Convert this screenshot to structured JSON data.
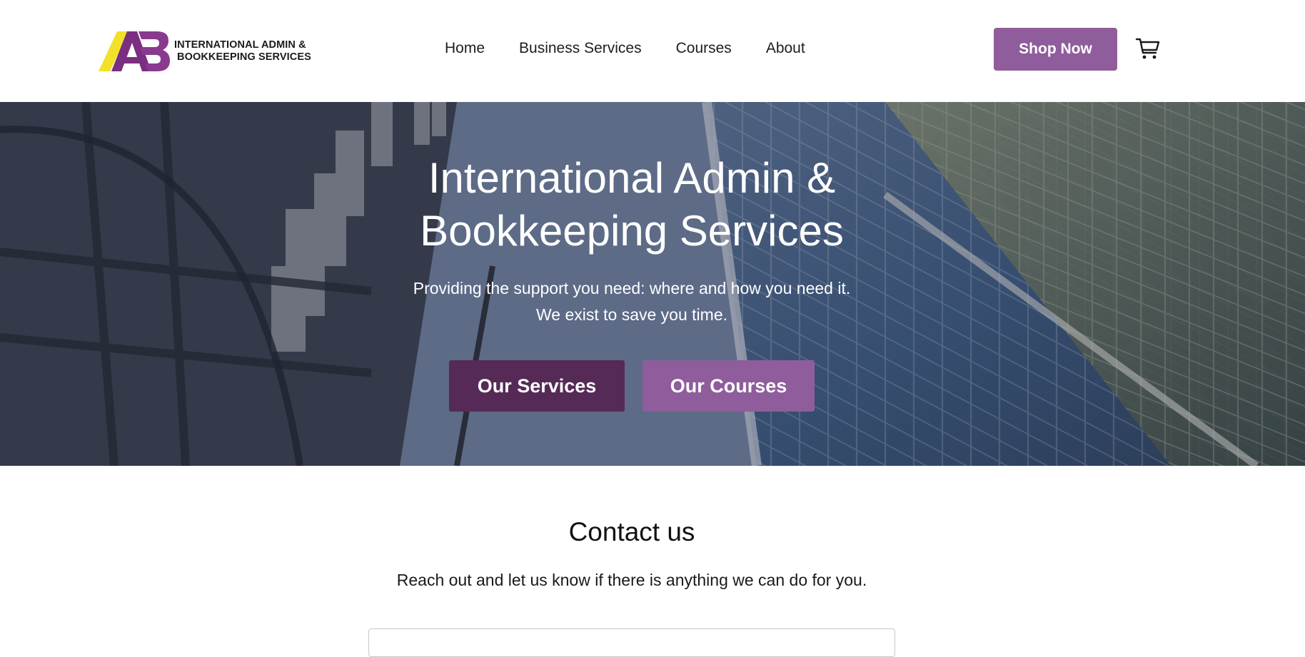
{
  "brand": {
    "logo_lines": [
      "INTERNATIONAL ADMIN &",
      "BOOKKEEPING SERVICES"
    ],
    "colors": {
      "purple": "#8f5d9b",
      "dark_purple": "#552a56",
      "yellow": "#f2e12b"
    }
  },
  "nav": {
    "items": [
      "Home",
      "Business Services",
      "Courses",
      "About"
    ]
  },
  "header": {
    "shop_label": "Shop Now",
    "cart_icon": "cart-icon"
  },
  "hero": {
    "title_lines": [
      "International Admin &",
      "Bookkeeping Services"
    ],
    "subtitle_lines": [
      "Providing the support you need: where and how you need it.",
      "We exist to save you time."
    ],
    "buttons": [
      "Our Services",
      "Our Courses"
    ]
  },
  "contact": {
    "title": "Contact us",
    "subtitle": "Reach out and let us know if there is anything we can do for you."
  }
}
